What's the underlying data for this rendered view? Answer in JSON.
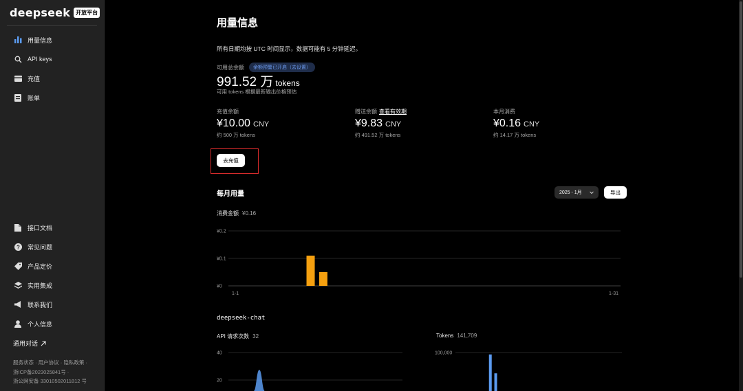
{
  "sidebar": {
    "logo": "deepseek",
    "badge": "开放平台",
    "nav_top": [
      {
        "label": "用量信息",
        "icon": "bar-chart-icon"
      },
      {
        "label": "API keys",
        "icon": "search-icon"
      },
      {
        "label": "充值",
        "icon": "wallet-icon"
      },
      {
        "label": "账单",
        "icon": "bill-icon"
      }
    ],
    "nav_bottom": [
      {
        "label": "接口文档",
        "icon": "document-icon"
      },
      {
        "label": "常见问题",
        "icon": "help-icon"
      },
      {
        "label": "产品定价",
        "icon": "tag-icon"
      },
      {
        "label": "实用集成",
        "icon": "layers-icon"
      },
      {
        "label": "联系我们",
        "icon": "megaphone-icon"
      },
      {
        "label": "个人信息",
        "icon": "user-icon"
      }
    ],
    "external_link": "通用对话",
    "footer": [
      "服务状态 · 用户协议 · 隐私政策 ·",
      "浙ICP备2023025841号 ·",
      "浙公网安备 33010502011812 号"
    ]
  },
  "main": {
    "title": "用量信息",
    "notice": "所有日期均按 UTC 时间显示，数据可能有 5 分钟延迟。",
    "available": {
      "label": "可用总余额",
      "badge": "余额预警已开启（去设置）",
      "amount": "991.52 万",
      "unit": "tokens",
      "sub": "可用 tokens 根据最新输出价格预估"
    },
    "balances": [
      {
        "label": "充值余额",
        "link": "",
        "amount": "¥10.00",
        "currency": "CNY",
        "sub": "约 500 万 tokens"
      },
      {
        "label": "赠送余额",
        "link": "查看有效期",
        "amount": "¥9.83",
        "currency": "CNY",
        "sub": "约 491.52 万 tokens"
      },
      {
        "label": "本月消费",
        "link": "",
        "amount": "¥0.16",
        "currency": "CNY",
        "sub": "约 14.17 万 tokens"
      }
    ],
    "recharge_button": "去充值",
    "monthly_title": "每月用量",
    "month_select": "2025 - 1月",
    "export_button": "导出",
    "spend_label": "消费金额",
    "spend_value": "¥0.16",
    "model_name": "deepseek-chat",
    "requests_label": "API 请求次数",
    "requests_value": "32",
    "tokens_label": "Tokens",
    "tokens_value": "141,709"
  },
  "colors": {
    "bar_orange": "#f5a00f",
    "line_blue": "#5b9bf0",
    "badge_blue": "#6d9cf0"
  },
  "chart_data": [
    {
      "type": "bar",
      "title": "消费金额",
      "x_range": [
        1,
        31
      ],
      "x_tick_labels": [
        "1-1",
        "1-31"
      ],
      "y_tick_labels": [
        "¥0",
        "¥0.1",
        "¥0.2"
      ],
      "ylim": [
        0,
        0.2
      ],
      "grid": true,
      "points": [
        {
          "day": 7,
          "value": 0.11
        },
        {
          "day": 8,
          "value": 0.05
        }
      ]
    },
    {
      "type": "area",
      "title": "API 请求次数",
      "x_range": [
        1,
        31
      ],
      "y_tick_labels": [
        "20",
        "40"
      ],
      "ylim": [
        0,
        40
      ],
      "grid": true,
      "points": [
        {
          "day": 4,
          "value": 0
        },
        {
          "day": 5,
          "value": 0
        },
        {
          "day": 6,
          "value": 22
        },
        {
          "day": 7,
          "value": 0
        }
      ]
    },
    {
      "type": "bar",
      "title": "Tokens",
      "x_range": [
        1,
        31
      ],
      "y_tick_labels": [
        "100,000"
      ],
      "ylim": [
        0,
        100000
      ],
      "grid": true,
      "points": [
        {
          "day": 7,
          "value": 95000
        },
        {
          "day": 8,
          "value": 46000
        }
      ]
    }
  ]
}
